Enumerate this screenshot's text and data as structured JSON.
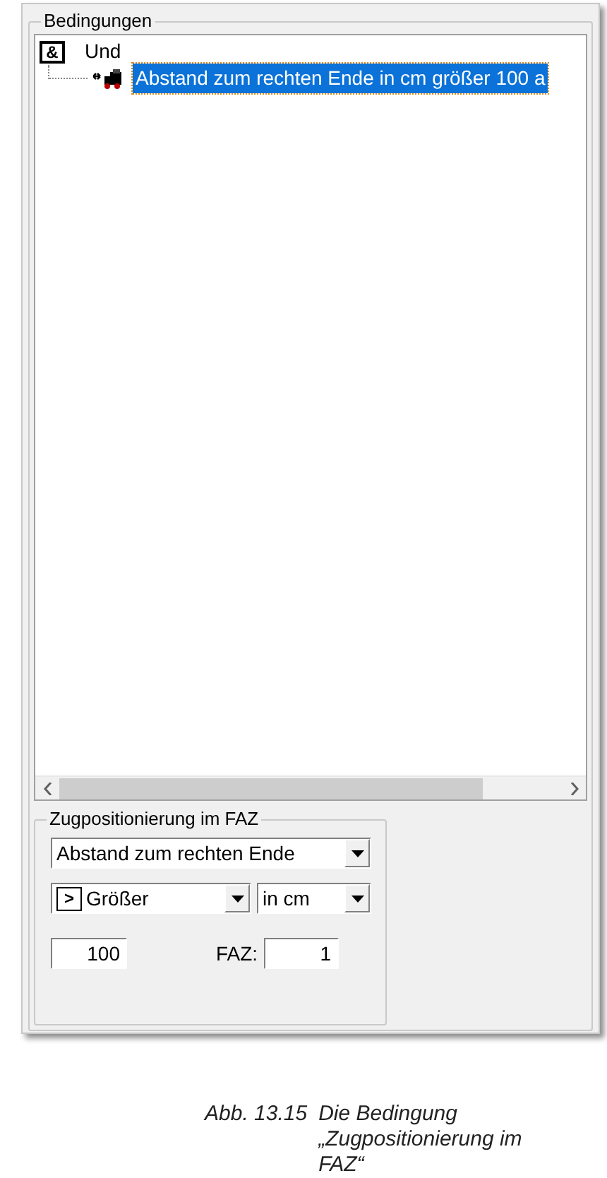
{
  "group_title": "Bedingungen",
  "tree": [
    {
      "label": "Und",
      "kind": "and",
      "symbol": "&",
      "selected": false,
      "children": [
        {
          "label": "Abstand zum rechten Ende in cm größer 100 a",
          "kind": "train",
          "selected": true
        }
      ]
    }
  ],
  "subgroup": {
    "title": "Zugpositionierung im FAZ",
    "mode_select": "Abstand zum rechten Ende",
    "comparison_symbol": ">",
    "comparison_select": "Größer",
    "unit_select": "in cm",
    "value": "100",
    "faz_label": "FAZ:",
    "faz_value": "1"
  },
  "caption": {
    "number": "Abb. 13.15",
    "text": "Die Bedingung „Zugpositionierung im FAZ“"
  }
}
